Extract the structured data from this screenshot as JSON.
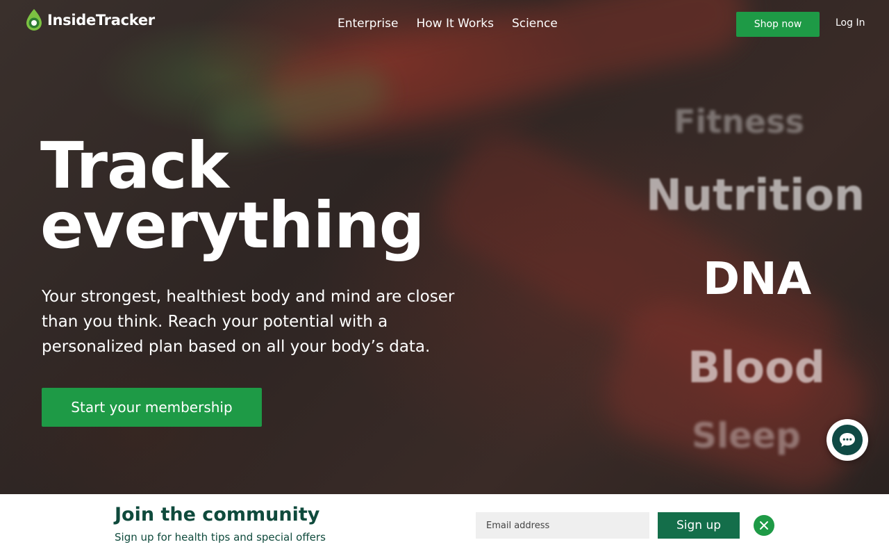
{
  "brand": {
    "name": "InsideTracker",
    "accent": "#1e9a46",
    "dark_green": "#0f4a3c"
  },
  "nav": {
    "items": [
      {
        "label": "Enterprise"
      },
      {
        "label": "How It Works"
      },
      {
        "label": "Science"
      }
    ],
    "shop_label": "Shop now",
    "login_label": "Log In"
  },
  "hero": {
    "headline_line1": "Track",
    "headline_line2": "everything",
    "subtext": "Your strongest, healthiest body and mind are closer than you think. Reach your potential with a personalized plan based on all your body’s data.",
    "cta_label": "Start your membership",
    "words": [
      "Fitness",
      "Nutrition",
      "DNA",
      "Blood",
      "Sleep"
    ]
  },
  "chat": {
    "icon": "chat-bubble-icon"
  },
  "newsletter": {
    "title": "Join the community",
    "subtitle": "Sign up for health tips and special offers",
    "email_placeholder": "Email address",
    "signup_label": "Sign up",
    "close_icon": "close-icon"
  }
}
